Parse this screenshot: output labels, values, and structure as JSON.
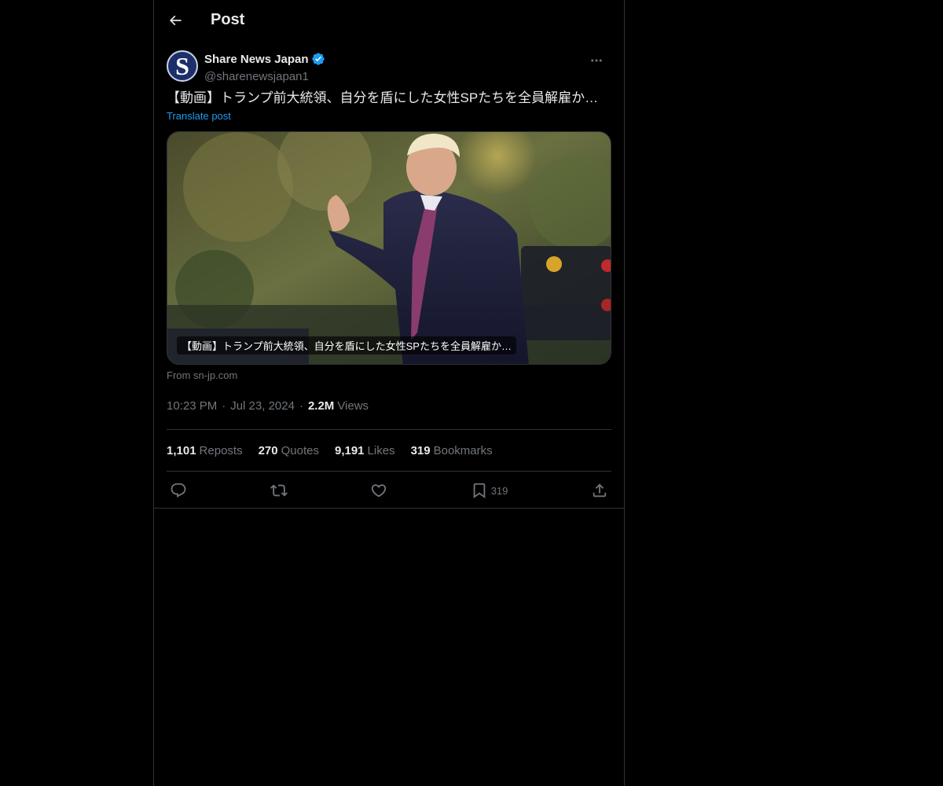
{
  "header": {
    "title": "Post",
    "back_icon": "arrow-left-icon"
  },
  "post": {
    "author": {
      "display_name": "Share News Japan",
      "handle": "@sharenewsjapan1",
      "avatar_letter": "S",
      "verified": true,
      "verified_color": "#1d9bf0"
    },
    "text": "【動画】トランプ前大統領、自分を盾にした女性SPたちを全員解雇か…",
    "translate_label": "Translate post",
    "card": {
      "caption": "【動画】トランプ前大統領、自分を盾にした女性SPたちを全員解雇か…",
      "source": "From sn-jp.com"
    },
    "time": "10:23 PM",
    "date": "Jul 23, 2024",
    "separator": "·",
    "views_count": "2.2M",
    "views_label": "Views",
    "stats": {
      "reposts_count": "1,101",
      "reposts_label": "Reposts",
      "quotes_count": "270",
      "quotes_label": "Quotes",
      "likes_count": "9,191",
      "likes_label": "Likes",
      "bookmarks_count": "319",
      "bookmarks_label": "Bookmarks"
    },
    "actions": {
      "reply_icon": "reply-icon",
      "repost_icon": "repost-icon",
      "like_icon": "heart-icon",
      "bookmark_icon": "bookmark-icon",
      "bookmark_count": "319",
      "share_icon": "share-icon"
    }
  },
  "colors": {
    "background": "#000000",
    "text": "#e7e9ea",
    "muted": "#71767b",
    "accent": "#1d9bf0",
    "border": "#2f3336"
  }
}
